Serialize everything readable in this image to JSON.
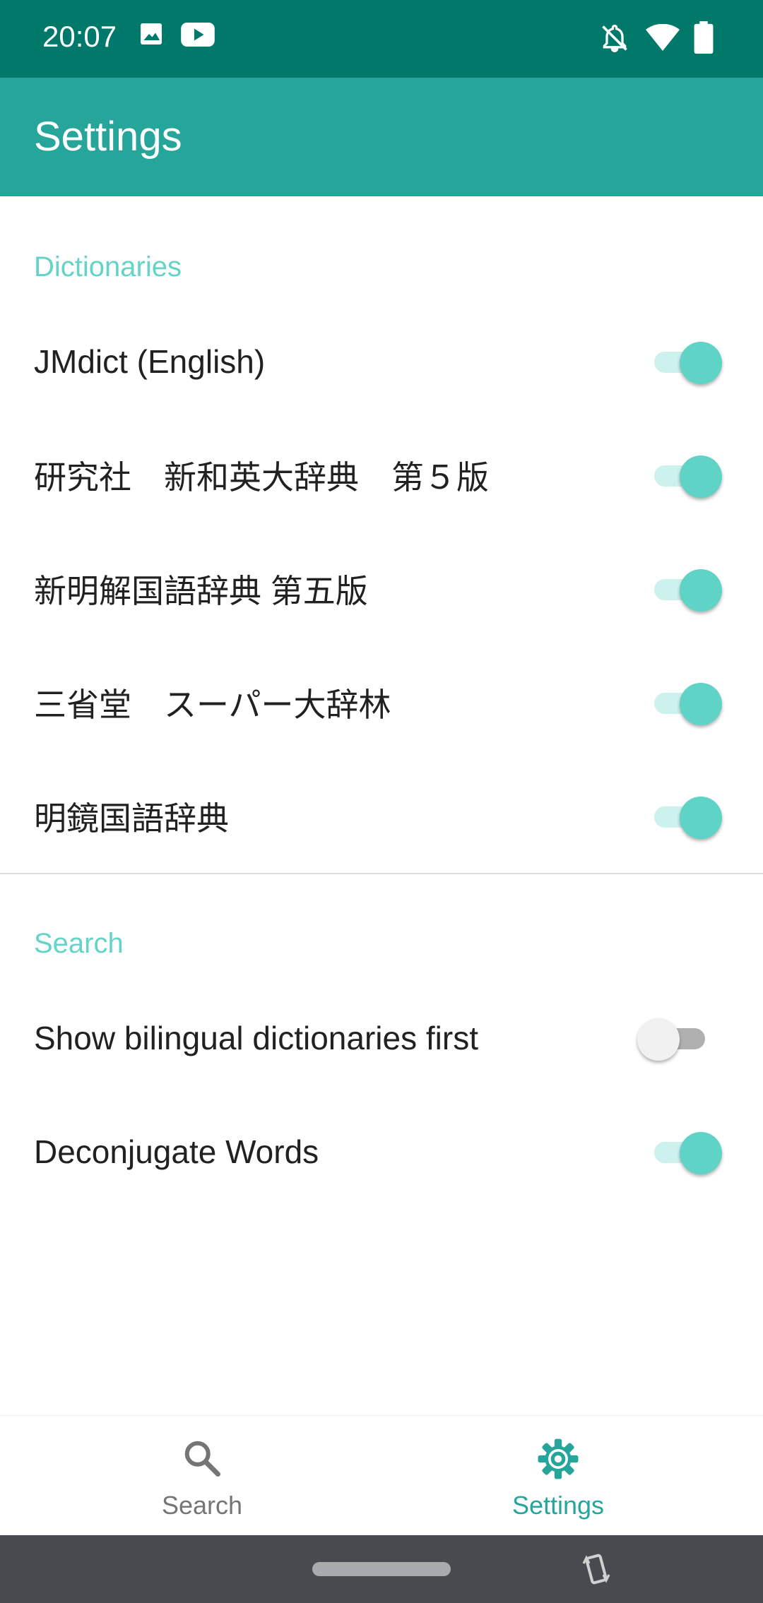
{
  "status_bar": {
    "time": "20:07",
    "left_icons": [
      "image-icon",
      "youtube-icon"
    ],
    "right_icons": [
      "bell-off-icon",
      "wifi-icon",
      "battery-icon"
    ],
    "background": "#00796b"
  },
  "app_bar": {
    "title": "Settings",
    "background": "#26a69a"
  },
  "sections": {
    "dictionaries": {
      "header": "Dictionaries",
      "items": [
        {
          "label": "JMdict (English)",
          "enabled": true
        },
        {
          "label": "研究社　新和英大辞典　第５版",
          "enabled": true
        },
        {
          "label": "新明解国語辞典 第五版",
          "enabled": true
        },
        {
          "label": "三省堂　スーパー大辞林",
          "enabled": true
        },
        {
          "label": "明鏡国語辞典",
          "enabled": true
        }
      ]
    },
    "search": {
      "header": "Search",
      "items": [
        {
          "label": "Show bilingual dictionaries first",
          "enabled": false
        },
        {
          "label": "Deconjugate Words",
          "enabled": true
        }
      ]
    }
  },
  "bottom_nav": {
    "items": [
      {
        "label": "Search",
        "icon": "search-icon",
        "active": false
      },
      {
        "label": "Settings",
        "icon": "gear-icon",
        "active": true
      }
    ],
    "active_color": "#26a69a",
    "inactive_color": "#757575"
  },
  "colors": {
    "accent": "#5fd3c5",
    "section_header": "#64d4c6"
  }
}
